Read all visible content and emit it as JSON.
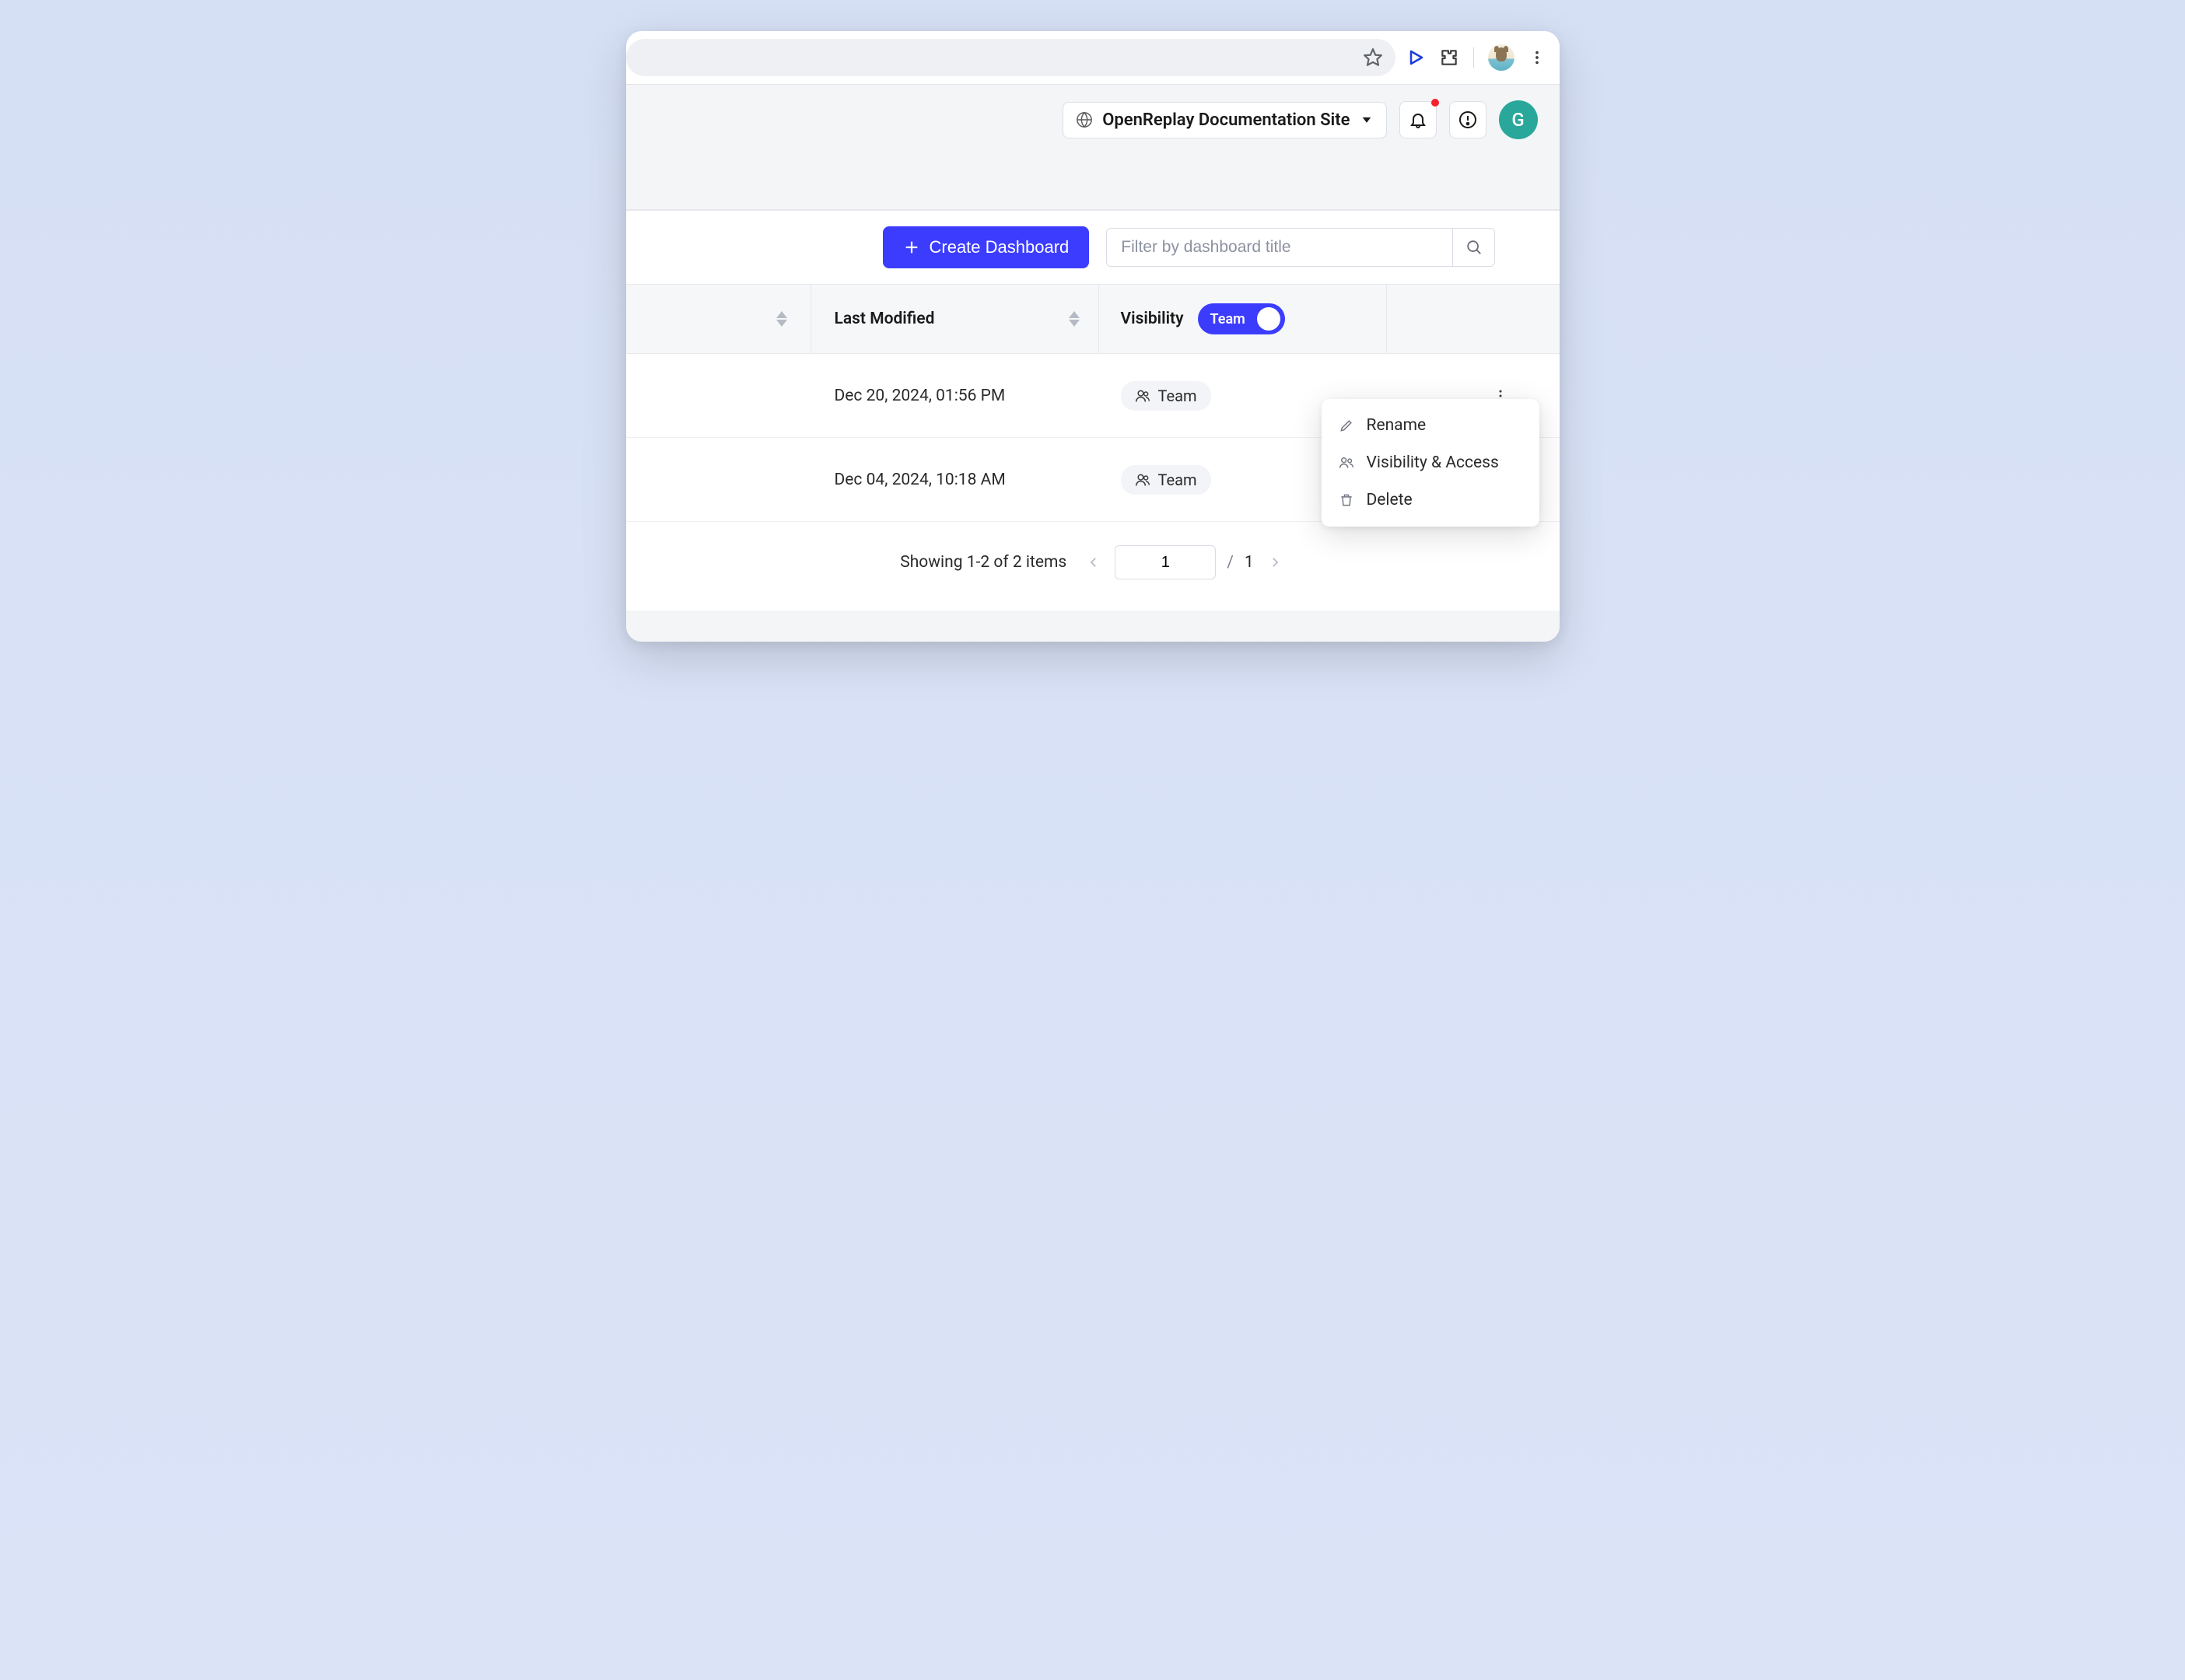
{
  "chrome": {
    "star_icon": "star",
    "play_icon": "play",
    "ext_icon": "extension",
    "menu_icon": "kebab"
  },
  "header": {
    "project_label": "OpenReplay Documentation Site",
    "avatar_initial": "G"
  },
  "toolbar": {
    "create_label": "Create Dashboard",
    "search_placeholder": "Filter by dashboard title"
  },
  "columns": {
    "last_modified": "Last Modified",
    "visibility": "Visibility",
    "toggle_label": "Team"
  },
  "rows": [
    {
      "last_modified": "Dec 20, 2024, 01:56 PM",
      "visibility": "Team"
    },
    {
      "last_modified": "Dec 04, 2024, 10:18 AM",
      "visibility": "Team"
    }
  ],
  "menu": {
    "rename": "Rename",
    "visibility_access": "Visibility & Access",
    "delete": "Delete"
  },
  "pagination": {
    "summary": "Showing 1-2 of 2 items",
    "current": "1",
    "separator": "/",
    "total": "1"
  }
}
